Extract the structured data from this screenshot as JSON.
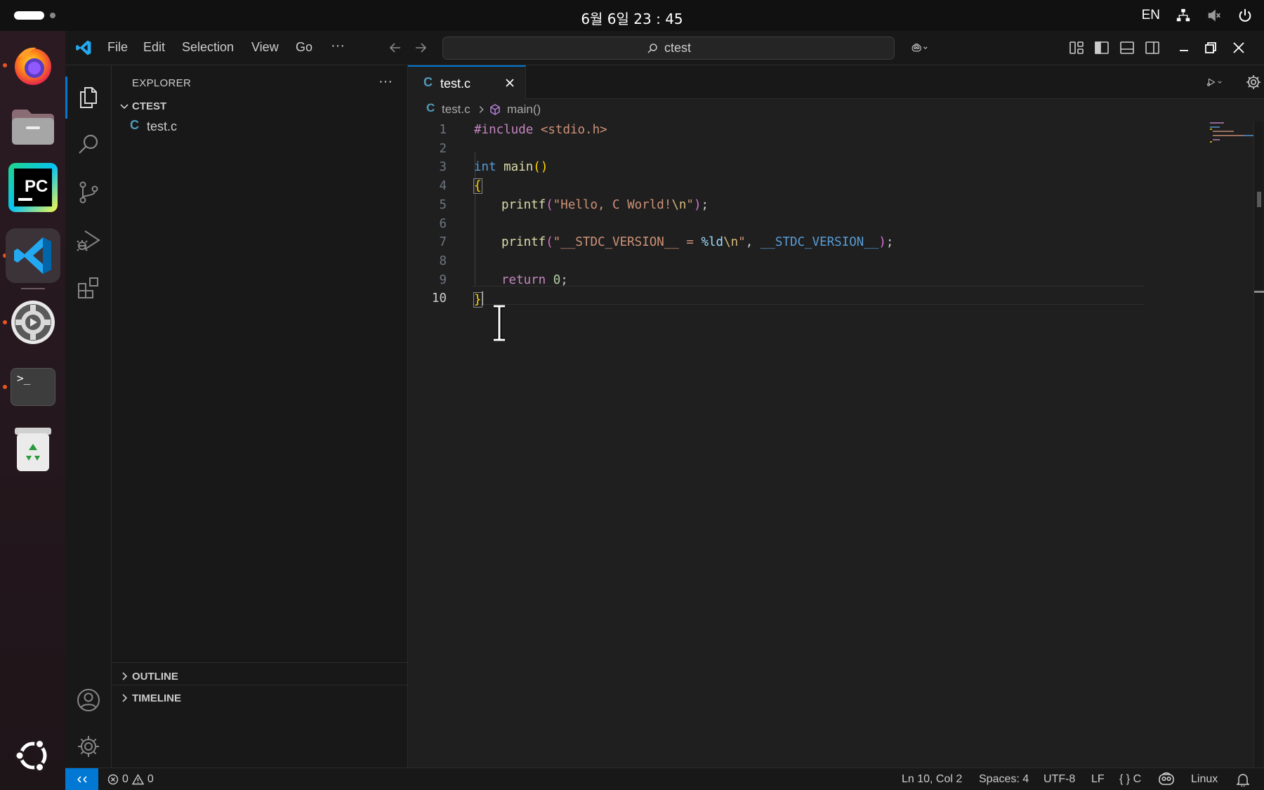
{
  "system": {
    "clock": "6월 6일 23 : 45",
    "language": "EN"
  },
  "dock": {
    "items": [
      "firefox",
      "files",
      "pycharm",
      "vscode",
      "settings",
      "terminal",
      "trash",
      "ubuntu-apps"
    ],
    "pycharm_label": "PC",
    "terminal_label": ">_"
  },
  "titlebar": {
    "menus": [
      "File",
      "Edit",
      "Selection",
      "View",
      "Go"
    ],
    "more": "···",
    "search_text": "ctest"
  },
  "sidebar": {
    "title": "EXPLORER",
    "more": "···",
    "folder": "CTEST",
    "files": [
      {
        "icon_letter": "C",
        "name": "test.c"
      }
    ],
    "outline": "OUTLINE",
    "timeline": "TIMELINE"
  },
  "editor": {
    "tab": {
      "icon_letter": "C",
      "name": "test.c"
    },
    "breadcrumb": {
      "file": "test.c",
      "symbol": "main()"
    },
    "line_numbers": [
      "1",
      "2",
      "3",
      "4",
      "5",
      "6",
      "7",
      "8",
      "9",
      "10"
    ],
    "current_line": 10,
    "lines": {
      "l1_directive": "#include",
      "l1_header": " <stdio.h>",
      "l3_type": "int",
      "l3_fn": " main",
      "l3_parens": "()",
      "l4_brace": "{",
      "l5_fn": "printf",
      "l5_open": "(",
      "l5_str_a": "\"Hello, C World!",
      "l5_esc": "\\n",
      "l5_str_b": "\"",
      "l5_close": ")",
      "l5_semi": ";",
      "l7_fn": "printf",
      "l7_open": "(",
      "l7_str_a": "\"__STDC_VERSION__ = ",
      "l7_fmt": "%ld",
      "l7_esc": "\\n",
      "l7_str_b": "\"",
      "l7_comma": ", ",
      "l7_macro": "__STDC_VERSION__",
      "l7_close": ")",
      "l7_semi": ";",
      "l9_kw": "return",
      "l9_num": " 0",
      "l9_semi": ";",
      "l10_brace": "}"
    }
  },
  "statusbar": {
    "errors": "0",
    "warnings": "0",
    "position": "Ln 10, Col 2",
    "spaces": "Spaces: 4",
    "encoding": "UTF-8",
    "eol": "LF",
    "language": "{ } C",
    "platform": "Linux"
  },
  "colors": {
    "accent": "#0078d4",
    "ubuntu_orange": "#e95420"
  }
}
